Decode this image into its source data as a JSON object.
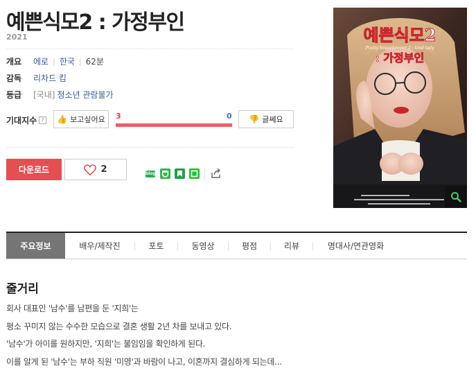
{
  "movie": {
    "title": "예쁜식모2 : 가정부인",
    "year": "2021"
  },
  "info": {
    "overview_label": "개요",
    "genre": "에로",
    "country": "한국",
    "runtime": "62분",
    "director_label": "감독",
    "director": "리차드 킴",
    "rating_label": "등급",
    "rating_region": "[국내]",
    "rating": "청소년 관람불가"
  },
  "expectation": {
    "label": "기대지수",
    "help_icon": "question-icon",
    "want_label": "보고싶어요",
    "meh_label": "글쎄요",
    "want_count": "3",
    "meh_count": "0",
    "want_ratio": 1.0,
    "colors": {
      "want": "#e53f4b",
      "meh": "#3b6fd8",
      "bar": "#ee5d63"
    }
  },
  "actions": {
    "download_label": "다운로드",
    "like_count": "2",
    "download_color": "#e54e52"
  },
  "share": {
    "blog_label": "blog",
    "icons": [
      "blog-icon",
      "band-icon",
      "bookmark-icon",
      "line-icon",
      "share-icon"
    ]
  },
  "poster": {
    "title_art": "예쁜식모2",
    "subtitle_art": ": 가정부인",
    "tagline": "Pretty housekeeper 2 : kind lady",
    "zoom_icon": "search-icon"
  },
  "tabs": [
    "주요정보",
    "배우/제작진",
    "포토",
    "동영상",
    "평점",
    "리뷰",
    "명대사/연관영화"
  ],
  "synopsis": {
    "heading": "줄거리",
    "lines": [
      "회사 대표인 '남수'를 남편을 둔 '지희'는",
      " 평소 꾸미지 않는 수수한 모습으로 결혼 생활 2년 차를 보내고 있다.",
      " '남수'가 아이를 원하지만, '지희'는 불임임을 확인하게 된다.",
      " 이를 알게 된 '남수'는 부하 직원 '미영'과 바람이 나고, 이혼까지 결심하게 되는데..."
    ]
  }
}
